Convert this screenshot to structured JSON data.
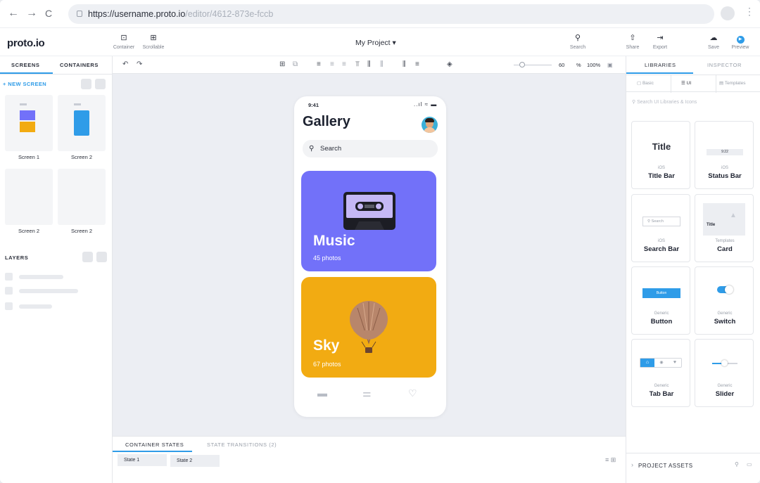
{
  "browser": {
    "url_main": "https://username.proto.io",
    "url_rest": "/editor/4612-873e-fccb",
    "back_icon": "←",
    "forward_icon": "→",
    "reload_icon": "C",
    "menu_icon": "⋮"
  },
  "toolbar": {
    "logo": "proto.io",
    "container_label": "Container",
    "scrollable_label": "Scrollable",
    "project_title": "My Project ▾",
    "search_label": "Search",
    "share_label": "Share",
    "export_label": "Export",
    "save_label": "Save",
    "preview_label": "Preview"
  },
  "left": {
    "tab_screens": "SCREENS",
    "tab_containers": "CONTAINERS",
    "new_screen": "+ NEW SCREEN",
    "screens": [
      {
        "label": "Screen 1"
      },
      {
        "label": "Screen 2"
      },
      {
        "label": "Screen 2"
      },
      {
        "label": "Screen 2"
      }
    ],
    "layers_title": "LAYERS"
  },
  "canvas": {
    "zoom_value": "60",
    "zoom_pct": "%",
    "zoom_100": "100%"
  },
  "phone": {
    "time": "9:41",
    "status_icons": "..ıl ≈ ▬",
    "title": "Gallery",
    "search_placeholder": "Search",
    "cards": [
      {
        "title": "Music",
        "subtitle": "45 photos",
        "color": "#7271f9"
      },
      {
        "title": "Sky",
        "subtitle": "67 photos",
        "color": "#f2ab12"
      }
    ]
  },
  "bottom": {
    "tab_states": "CONTAINER STATES",
    "tab_transitions": "STATE TRANSITIONS (2)",
    "state1": "State 1",
    "state2": "State 2"
  },
  "right": {
    "tab_libraries": "LIBRARIES",
    "tab_inspector": "INSPECTOR",
    "sub_basic": "Basic",
    "sub_ui": "UI",
    "sub_templates": "Templates",
    "search_placeholder": "Search UI Libraries & Icons",
    "components": [
      {
        "cat": "iOS",
        "name": "Title Bar",
        "preview": "Title"
      },
      {
        "cat": "iOS",
        "name": "Status Bar",
        "preview": "9:22"
      },
      {
        "cat": "iOS",
        "name": "Search Bar",
        "preview": "Search"
      },
      {
        "cat": "Templates",
        "name": "Card",
        "preview": "Title"
      },
      {
        "cat": "Generic",
        "name": "Button",
        "preview": "Button"
      },
      {
        "cat": "Generic",
        "name": "Switch",
        "preview": ""
      },
      {
        "cat": "Generic",
        "name": "Tab Bar",
        "preview": ""
      },
      {
        "cat": "Generic",
        "name": "Slider",
        "preview": ""
      }
    ],
    "project_assets": "PROJECT ASSETS"
  },
  "colors": {
    "accent": "#2f9ce8",
    "music": "#7271f9",
    "sky": "#f2ab12"
  }
}
